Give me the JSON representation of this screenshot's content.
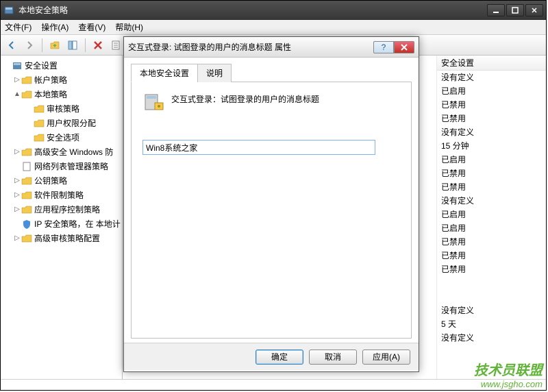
{
  "window": {
    "title": "本地安全策略"
  },
  "menu": {
    "file": "文件(F)",
    "action": "操作(A)",
    "view": "查看(V)",
    "help": "帮助(H)"
  },
  "tree": {
    "root": "安全设置",
    "account": "帐户策略",
    "local": "本地策略",
    "audit": "审核策略",
    "rights": "用户权限分配",
    "options": "安全选项",
    "firewall": "高级安全 Windows 防",
    "netlist": "网络列表管理器策略",
    "pubkey": "公钥策略",
    "software": "软件限制策略",
    "appctrl": "应用程序控制策略",
    "ipsec": "IP 安全策略，在 本地计",
    "advaudit": "高级审核策略配置"
  },
  "list": {
    "header": "安全设置",
    "rows": [
      "没有定义",
      "已启用",
      "已禁用",
      "已禁用",
      "没有定义",
      "15 分钟",
      "已启用",
      "已禁用",
      "已禁用",
      "没有定义",
      "已启用",
      "已启用",
      "已禁用",
      "已禁用",
      "已禁用"
    ],
    "rows2": [
      "没有定义",
      "5 天",
      "没有定义"
    ]
  },
  "dialog": {
    "title": "交互式登录: 试图登录的用户的消息标题 属性",
    "tab1": "本地安全设置",
    "tab2": "说明",
    "policy_label": "交互式登录：试图登录的用户的消息标题",
    "input_value": "Win8系统之家",
    "ok": "确定",
    "cancel": "取消",
    "apply": "应用(A)"
  },
  "watermark": {
    "line1": "技术员联盟",
    "line2": "www.jsgho.com"
  }
}
